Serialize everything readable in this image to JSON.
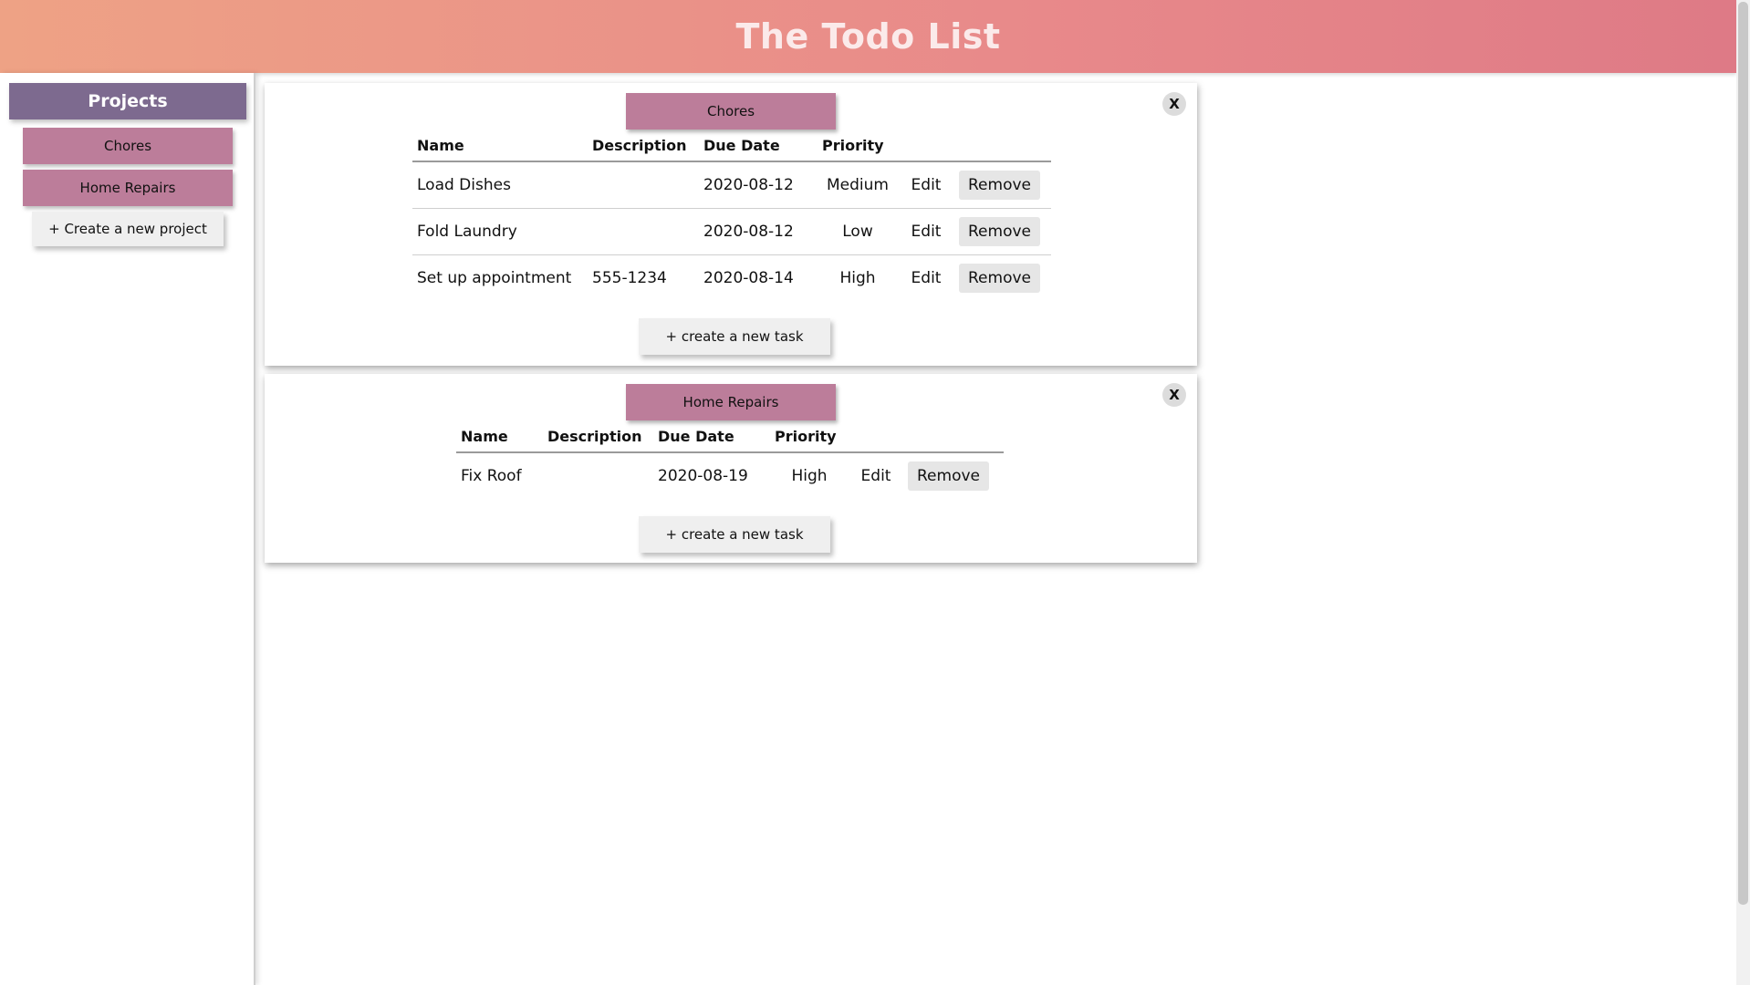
{
  "header": {
    "title": "The Todo List"
  },
  "sidebar": {
    "title": "Projects",
    "projects": [
      "Chores",
      "Home Repairs"
    ],
    "create_label": "+ Create a new project"
  },
  "columns": {
    "name": "Name",
    "description": "Description",
    "due_date": "Due Date",
    "priority": "Priority"
  },
  "actions": {
    "edit": "Edit",
    "remove": "Remove",
    "close": "X",
    "create_task": "+ create a new task"
  },
  "cards": [
    {
      "title": "Chores",
      "tasks": [
        {
          "name": "Load Dishes",
          "description": "",
          "due": "2020-08-12",
          "priority": "Medium"
        },
        {
          "name": "Fold Laundry",
          "description": "",
          "due": "2020-08-12",
          "priority": "Low"
        },
        {
          "name": "Set up appointment",
          "description": "555-1234",
          "due": "2020-08-14",
          "priority": "High"
        }
      ]
    },
    {
      "title": "Home Repairs",
      "tasks": [
        {
          "name": "Fix Roof",
          "description": "",
          "due": "2020-08-19",
          "priority": "High"
        }
      ]
    }
  ],
  "colors": {
    "header_start": "#eea285",
    "header_end": "#de7a86",
    "projects_title": "#7d6a8f",
    "project_item": "#bc7d9a"
  }
}
